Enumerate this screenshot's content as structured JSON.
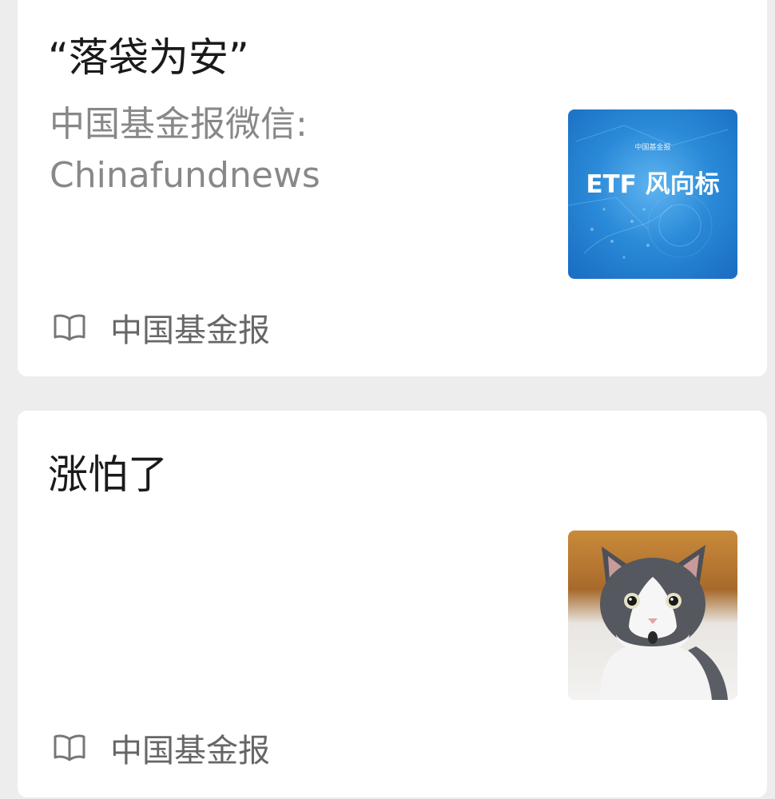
{
  "feed": {
    "items": [
      {
        "title": "“落袋为安”",
        "subtitle_lines": [
          "中国基金报微信:",
          "Chinafundnews"
        ],
        "thumbnail": {
          "text": "ETF 风向标",
          "logo_text": "中国基金报",
          "bg_color": "#2a8ad8"
        },
        "source": {
          "icon": "book-open-icon",
          "name": "中国基金报"
        }
      },
      {
        "title": "涨怕了",
        "thumbnail": {
          "subject": "surprised-cat"
        },
        "source": {
          "icon": "book-open-icon",
          "name": "中国基金报"
        }
      }
    ]
  }
}
